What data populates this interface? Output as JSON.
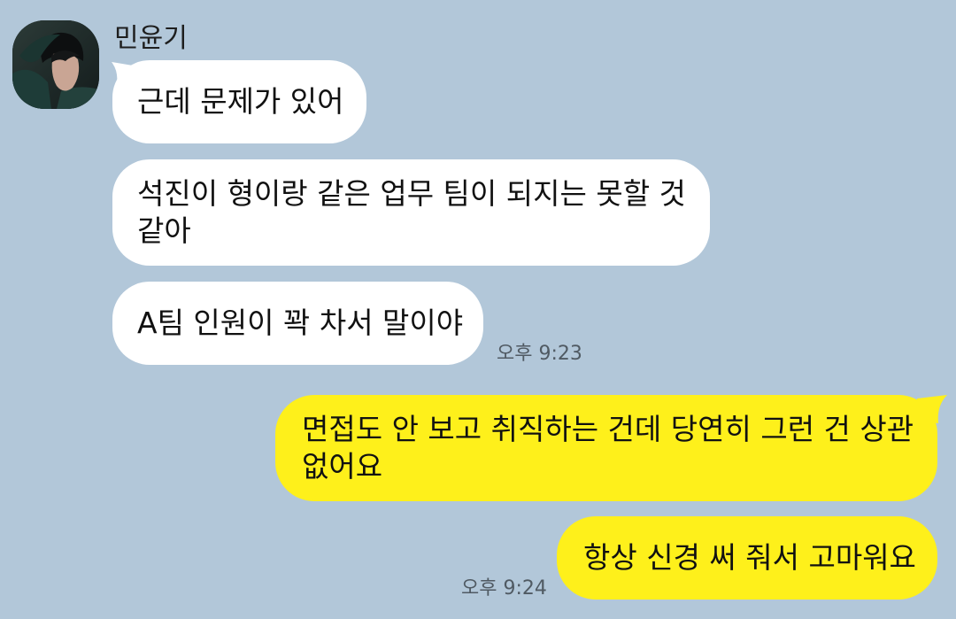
{
  "colors": {
    "background": "#b2c7d9",
    "incoming_bubble": "#ffffff",
    "outgoing_bubble": "#fef01b",
    "timestamp_text": "#505a63"
  },
  "sender": {
    "name": "민윤기",
    "avatar_icon": "profile-photo-avatar"
  },
  "messages": {
    "incoming_1": "근데 문제가 있어",
    "incoming_2_line1": "석진이 형이랑 같은 업무 팀이 되지는 못할 것",
    "incoming_2_line2": "같아",
    "incoming_3": "A팀 인원이 꽉 차서 말이야",
    "incoming_time": "오후 9:23",
    "outgoing_1_line1": "면접도 안 보고 취직하는 건데 당연히 그런 건 상관",
    "outgoing_1_line2": "없어요",
    "outgoing_2": "항상 신경 써 줘서 고마워요",
    "outgoing_time": "오후 9:24"
  }
}
